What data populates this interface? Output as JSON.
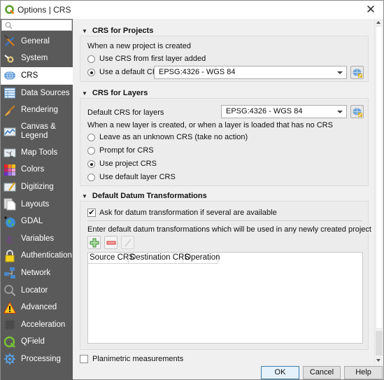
{
  "window": {
    "title": "Options | CRS",
    "close_icon": "close-icon"
  },
  "sidebar": {
    "search_placeholder": "",
    "items": [
      {
        "label": "General",
        "icon": "hammer-wrench-icon"
      },
      {
        "label": "System",
        "icon": "system-gear-icon"
      },
      {
        "label": "CRS",
        "icon": "globe-icon",
        "active": true
      },
      {
        "label": "Data Sources",
        "icon": "table-icon"
      },
      {
        "label": "Rendering",
        "icon": "paintbrush-icon"
      },
      {
        "label": "Canvas & Legend",
        "icon": "canvas-map-icon"
      },
      {
        "label": "Map Tools",
        "icon": "map-tools-icon"
      },
      {
        "label": "Colors",
        "icon": "color-grid-icon"
      },
      {
        "label": "Digitizing",
        "icon": "digitizing-icon"
      },
      {
        "label": "Layouts",
        "icon": "layouts-icon"
      },
      {
        "label": "GDAL",
        "icon": "gdal-globe-icon"
      },
      {
        "label": "Variables",
        "icon": "epsilon-icon"
      },
      {
        "label": "Authentication",
        "icon": "padlock-icon"
      },
      {
        "label": "Network",
        "icon": "network-icon"
      },
      {
        "label": "Locator",
        "icon": "magnifier-icon"
      },
      {
        "label": "Advanced",
        "icon": "warning-icon"
      },
      {
        "label": "Acceleration",
        "icon": "chip-icon"
      },
      {
        "label": "QField",
        "icon": "qfield-icon"
      },
      {
        "label": "Processing",
        "icon": "processing-gear-icon"
      }
    ]
  },
  "crs_projects": {
    "header": "CRS for Projects",
    "prompt": "When a new project is created",
    "options": [
      {
        "label": "Use CRS from first layer added",
        "selected": false
      },
      {
        "label": "Use a default CRS",
        "selected": true
      }
    ],
    "default_crs": "EPSG:4326 - WGS 84"
  },
  "crs_layers": {
    "header": "CRS for Layers",
    "default_label": "Default CRS for layers",
    "default_crs": "EPSG:4326 - WGS 84",
    "prompt": "When a new layer is created, or when a layer is loaded that has no CRS",
    "options": [
      {
        "label": "Leave as an unknown CRS (take no action)",
        "selected": false
      },
      {
        "label": "Prompt for CRS",
        "selected": false
      },
      {
        "label": "Use project CRS",
        "selected": true
      },
      {
        "label": "Use default layer CRS",
        "selected": false
      }
    ]
  },
  "datum": {
    "header": "Default Datum Transformations",
    "ask_label": "Ask for datum transformation if several are available",
    "ask_checked": true,
    "instructions": "Enter default datum transformations which will be used in any newly created project",
    "columns": [
      "Source CRS",
      "Destination CRS",
      "Operation"
    ],
    "rows": []
  },
  "planimetric": {
    "label": "Planimetric measurements",
    "checked": false
  },
  "buttons": {
    "ok": "OK",
    "cancel": "Cancel",
    "help": "Help"
  }
}
